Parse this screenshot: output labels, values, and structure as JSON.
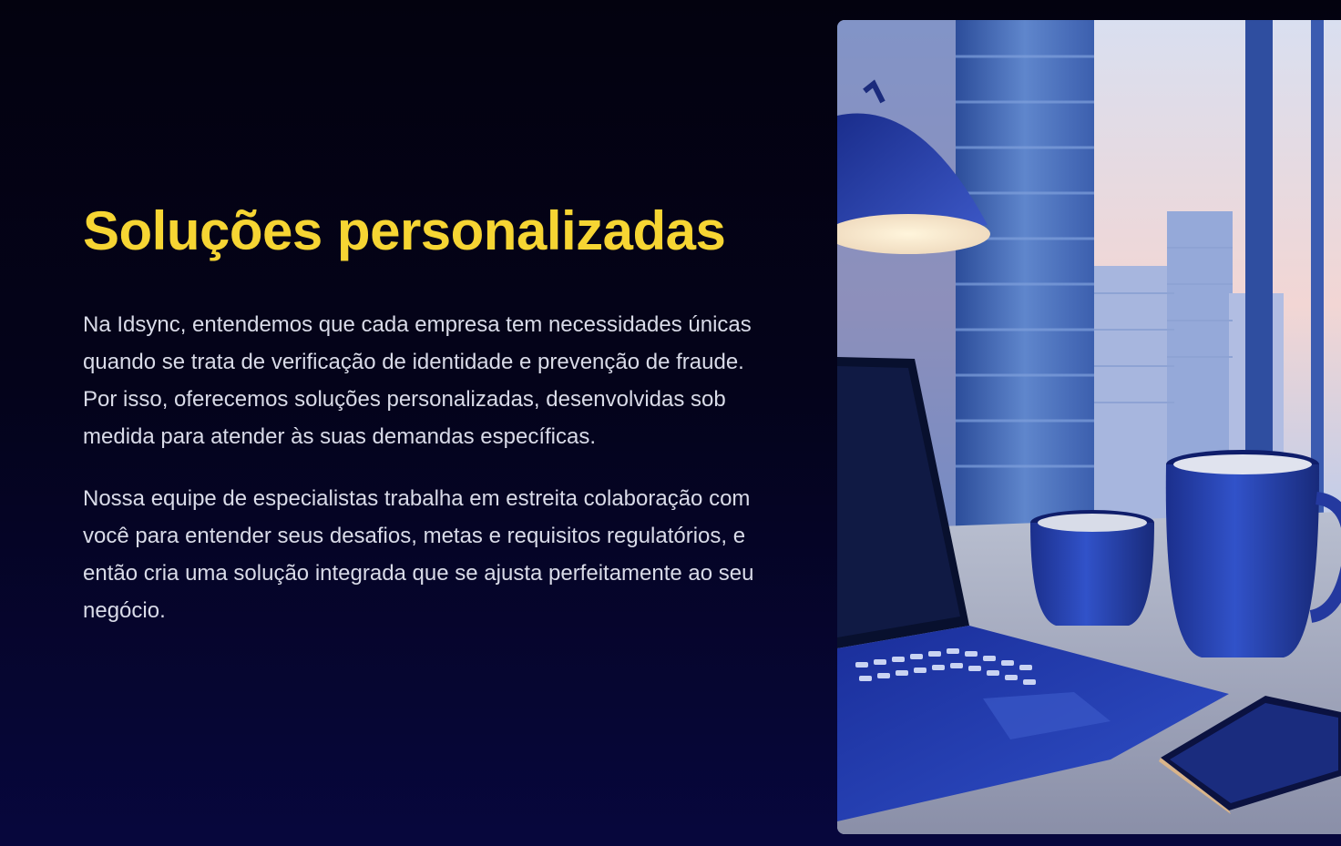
{
  "section": {
    "title": "Soluções personalizadas",
    "paragraphs": [
      "Na Idsync, entendemos que cada empresa tem necessidades únicas quando se trata de verificação de identidade e prevenção de fraude. Por isso, oferecemos soluções personalizadas, desenvolvidas sob medida para atender às suas demandas específicas.",
      "Nossa equipe de especialistas trabalha em estreita colaboração com você para entender seus desafios, metas e requisitos regulatórios, e então cria uma solução integrada que se ajusta perfeitamente ao seu negócio."
    ]
  },
  "colors": {
    "heading": "#f6d533",
    "body_text": "#d9dbe8",
    "background": "#04031a",
    "accent_blue": "#1f3fb0"
  },
  "image": {
    "subject": "office-desk-photo"
  }
}
